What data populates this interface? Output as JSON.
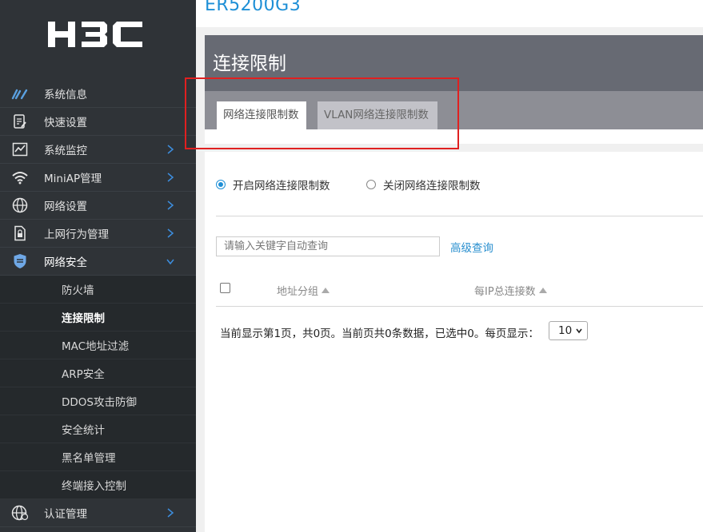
{
  "brand": {
    "logo_text": "H3C"
  },
  "device": {
    "title": "ER5200G3"
  },
  "sidebar": {
    "items": [
      {
        "label": "系统信息",
        "icon": "gauge-icon"
      },
      {
        "label": "快速设置",
        "icon": "clipboard-edit-icon"
      },
      {
        "label": "系统监控",
        "icon": "monitor-chart-icon",
        "has_children": true
      },
      {
        "label": "MiniAP管理",
        "icon": "wifi-icon",
        "has_children": true
      },
      {
        "label": "网络设置",
        "icon": "globe-icon",
        "has_children": true
      },
      {
        "label": "上网行为管理",
        "icon": "document-lock-icon",
        "has_children": true
      },
      {
        "label": "网络安全",
        "icon": "shield-icon",
        "has_children": true,
        "expanded": true
      }
    ],
    "security_sub": [
      "防火墙",
      "连接限制",
      "MAC地址过滤",
      "ARP安全",
      "DDOS攻击防御",
      "安全统计",
      "黑名单管理",
      "终端接入控制"
    ],
    "active_sub": "连接限制",
    "bottom_item": {
      "label": "认证管理",
      "icon": "globe-user-icon",
      "has_children": true
    }
  },
  "panel": {
    "title": "连接限制",
    "tabs": [
      {
        "label": "网络连接限制数",
        "active": true
      },
      {
        "label": "VLAN网络连接限制数",
        "active": false
      }
    ]
  },
  "radios": {
    "enable_label": "开启网络连接限制数",
    "disable_label": "关闭网络连接限制数",
    "selected": "enable"
  },
  "search": {
    "placeholder": "请输入关键字自动查询",
    "advanced_label": "高级查询"
  },
  "table": {
    "columns": [
      "地址分组",
      "每IP总连接数"
    ]
  },
  "pagination": {
    "info": "当前显示第1页，共0页。当前页共0条数据，已选中0。每页显示：",
    "page_size": "10"
  },
  "colors": {
    "sidebar_bg": "#2f3337",
    "accent": "#1e8fd6",
    "panel_header": "#676a73",
    "tabbar": "#8d8e95",
    "highlight": "#e02020"
  }
}
